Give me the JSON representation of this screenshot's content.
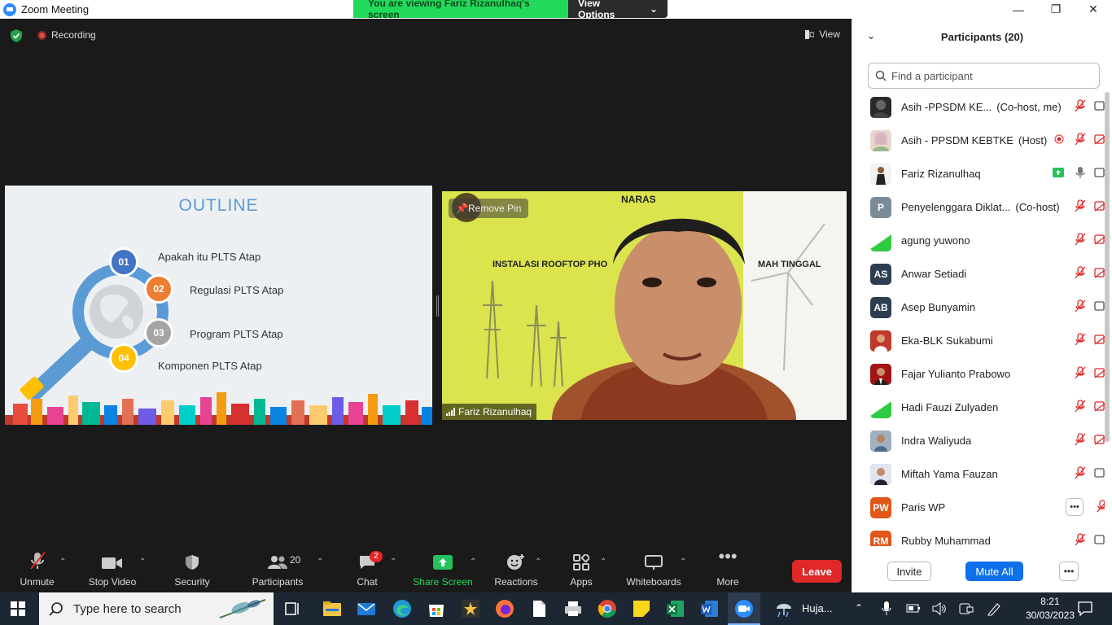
{
  "window": {
    "title": "Zoom Meeting"
  },
  "banner": {
    "message": "You are viewing Fariz Rizanulhaq's screen",
    "view_options": "View Options"
  },
  "meeting": {
    "recording_label": "Recording",
    "view_label": "View",
    "slide": {
      "title": "OUTLINE",
      "items": [
        {
          "num": "01",
          "text": "Apakah itu PLTS Atap",
          "color": "#4472c4"
        },
        {
          "num": "02",
          "text": "Regulasi PLTS Atap",
          "color": "#ed7d31"
        },
        {
          "num": "03",
          "text": "Program PLTS Atap",
          "color": "#a5a5a5"
        },
        {
          "num": "04",
          "text": "Komponen PLTS Atap",
          "color": "#ffc000"
        }
      ]
    },
    "video": {
      "remove_pin": "Remove Pin",
      "speaker_name": "Fariz Rizanulhaq",
      "bg_text_top": "NARAS",
      "bg_text_left": "INSTALASI ROOFTOP PHO",
      "bg_text_right": "MAH TINGGAL"
    }
  },
  "toolbar": {
    "unmute": "Unmute",
    "stop_video": "Stop Video",
    "security": "Security",
    "participants": "Participants",
    "participants_count": "20",
    "chat": "Chat",
    "chat_badge": "2",
    "share_screen": "Share Screen",
    "reactions": "Reactions",
    "apps": "Apps",
    "whiteboards": "Whiteboards",
    "more": "More",
    "leave": "Leave"
  },
  "panel": {
    "title": "Participants (20)",
    "search_placeholder": "Find a participant",
    "participants": [
      {
        "name": "Asih -PPSDM KE...",
        "tag": "(Co-host, me)",
        "avatar": "photo",
        "avatar_color": "#555"
      },
      {
        "name": "Asih - PPSDM KEBTKE",
        "tag": "(Host)",
        "avatar": "photo",
        "avatar_color": "#c9a38a"
      },
      {
        "name": "Fariz Rizanulhaq",
        "tag": "",
        "avatar": "photo",
        "avatar_color": "#444"
      },
      {
        "name": "Penyelenggara Diklat...",
        "tag": "(Co-host)",
        "avatar": "P",
        "avatar_color": "#7a8c99"
      },
      {
        "name": "agung yuwono",
        "tag": "",
        "avatar": "logo",
        "avatar_color": "#2ecc40"
      },
      {
        "name": "Anwar Setiadi",
        "tag": "",
        "avatar": "AS",
        "avatar_color": "#2d3e50"
      },
      {
        "name": "Asep Bunyamin",
        "tag": "",
        "avatar": "AB",
        "avatar_color": "#2d3e50"
      },
      {
        "name": "Eka-BLK Sukabumi",
        "tag": "",
        "avatar": "photo",
        "avatar_color": "#b22222"
      },
      {
        "name": "Fajar Yulianto Prabowo",
        "tag": "",
        "avatar": "photo",
        "avatar_color": "#8b1a1a"
      },
      {
        "name": "Hadi Fauzi Zulyaden",
        "tag": "",
        "avatar": "logo",
        "avatar_color": "#2ecc40"
      },
      {
        "name": "Indra Waliyuda",
        "tag": "",
        "avatar": "photo",
        "avatar_color": "#5a6a7a"
      },
      {
        "name": "Miftah Yama Fauzan",
        "tag": "",
        "avatar": "photo",
        "avatar_color": "#3a5a7a"
      },
      {
        "name": "Paris WP",
        "tag": "",
        "avatar": "PW",
        "avatar_color": "#e0561b"
      },
      {
        "name": "Rubby Muhammad",
        "tag": "",
        "avatar": "RM",
        "avatar_color": "#e0561b"
      }
    ],
    "invite": "Invite",
    "mute_all": "Mute All"
  },
  "taskbar": {
    "search_placeholder": "Type here to search",
    "weather": "Huja...",
    "time": "8:21",
    "date": "30/03/2023"
  }
}
